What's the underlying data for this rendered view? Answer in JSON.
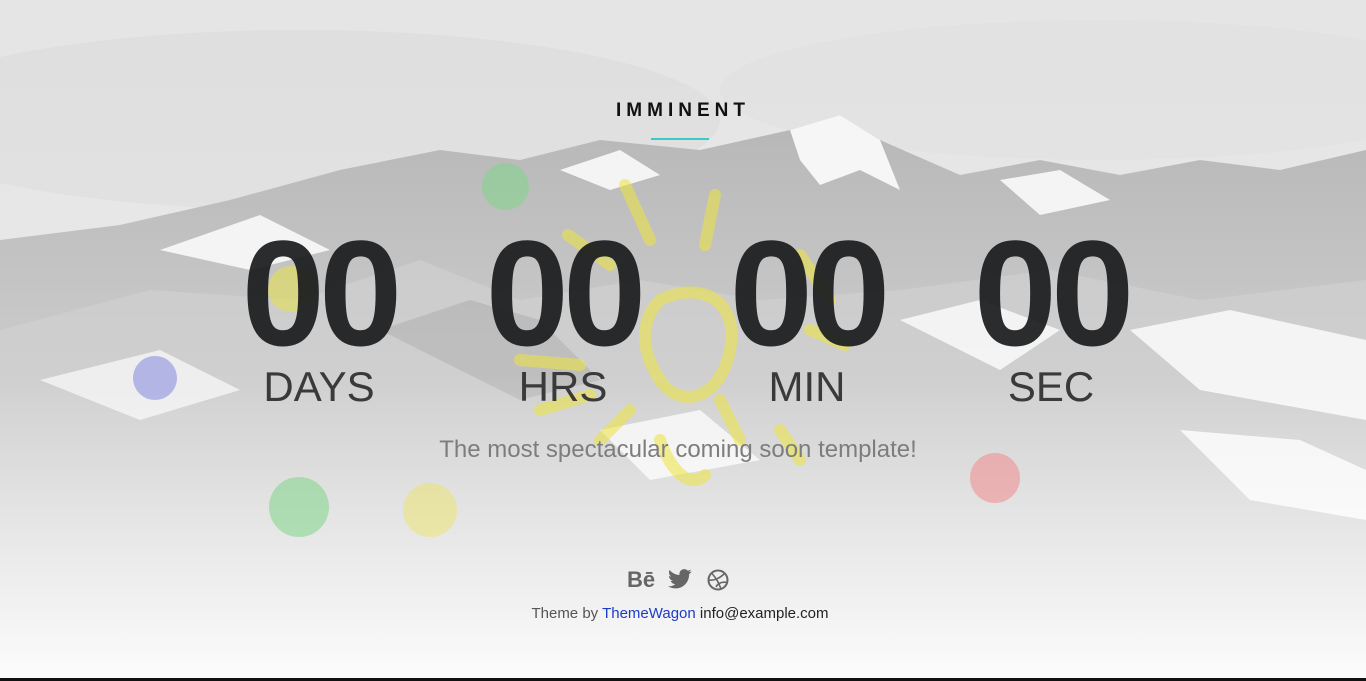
{
  "brand": {
    "title": "IMMINENT",
    "accent_color": "#3ec9c9"
  },
  "countdown": {
    "days": {
      "value": "00",
      "label": "DAYS"
    },
    "hours": {
      "value": "00",
      "label": "HRS"
    },
    "minutes": {
      "value": "00",
      "label": "MIN"
    },
    "seconds": {
      "value": "00",
      "label": "SEC"
    }
  },
  "tagline": "The most spectacular coming soon template!",
  "social": {
    "behance": {
      "icon": "behance-icon",
      "glyph": "Bē"
    },
    "twitter": {
      "icon": "twitter-icon"
    },
    "dribbble": {
      "icon": "dribbble-icon"
    }
  },
  "footer": {
    "prefix": "Theme by",
    "link_text": "ThemeWagon",
    "email": "info@example.com"
  },
  "bubbles": [
    {
      "color": "#7fd68a"
    },
    {
      "color": "#e8e14a"
    },
    {
      "color": "#8c8fe0"
    },
    {
      "color": "#7fd68a"
    },
    {
      "color": "#ece55a"
    },
    {
      "color": "#f08a8a"
    }
  ]
}
